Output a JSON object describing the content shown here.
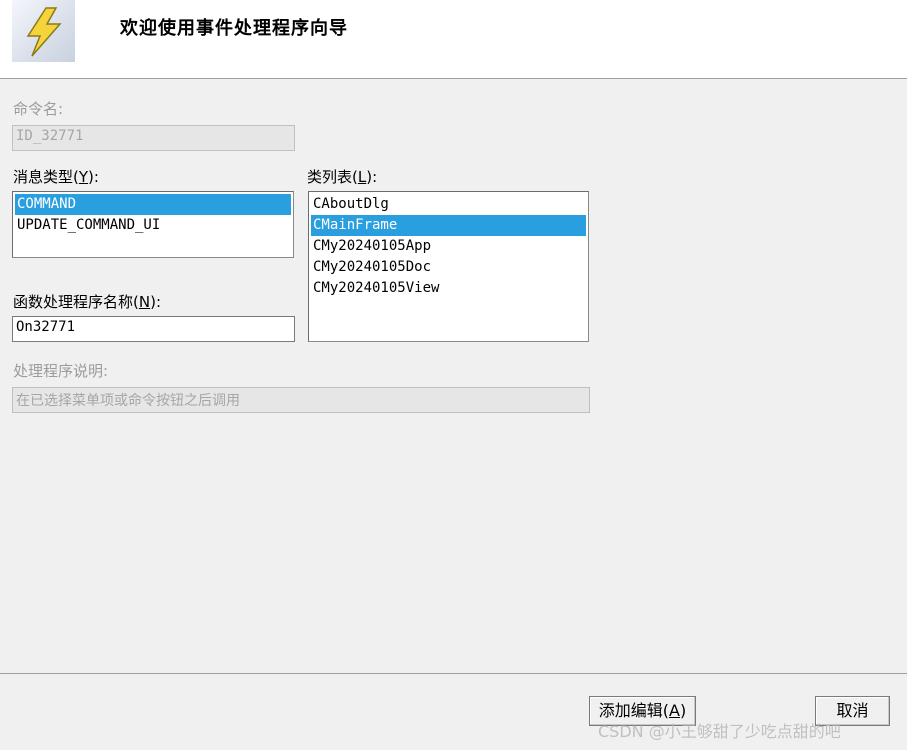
{
  "header": {
    "title": "欢迎使用事件处理程序向导",
    "icon": "lightning-icon"
  },
  "command_name": {
    "label": "命令名:",
    "value": "ID_32771"
  },
  "message_type": {
    "label_prefix": "消息类型(",
    "label_mnemonic": "Y",
    "label_suffix": "):",
    "items": [
      "COMMAND",
      "UPDATE_COMMAND_UI"
    ],
    "selected": "COMMAND"
  },
  "class_list": {
    "label_prefix": "类列表(",
    "label_mnemonic": "L",
    "label_suffix": "):",
    "items": [
      "CAboutDlg",
      "CMainFrame",
      "CMy20240105App",
      "CMy20240105Doc",
      "CMy20240105View"
    ],
    "selected": "CMainFrame"
  },
  "function_name": {
    "label_prefix": "函数处理程序名称(",
    "label_mnemonic": "N",
    "label_suffix": "):",
    "value": "On32771"
  },
  "handler_description": {
    "label": "处理程序说明:",
    "value": "在已选择菜单项或命令按钮之后调用"
  },
  "buttons": {
    "add_edit_prefix": "添加编辑(",
    "add_edit_mnemonic": "A",
    "add_edit_suffix": ")",
    "cancel": "取消"
  },
  "watermark": "CSDN @小王够甜了少吃点甜的吧",
  "colors": {
    "selection": "#2a9fe0",
    "dialog_bg": "#f0f0f0"
  }
}
